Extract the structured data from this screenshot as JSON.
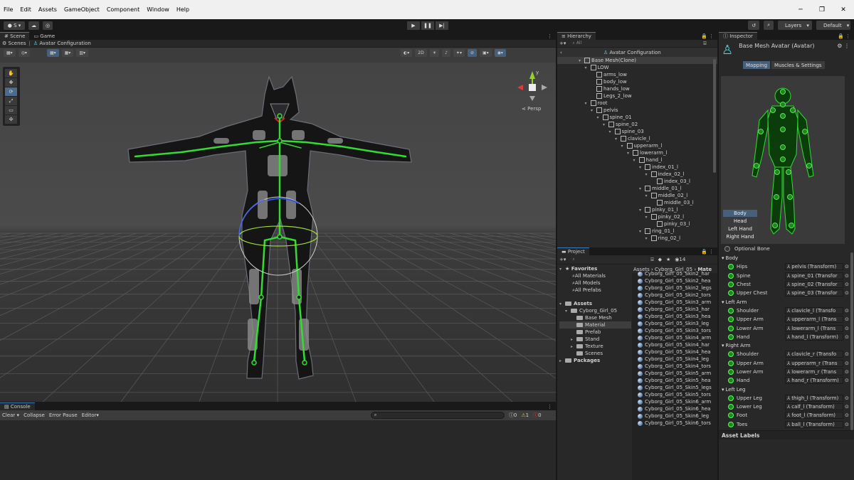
{
  "menu": [
    "File",
    "Edit",
    "Assets",
    "GameObject",
    "Component",
    "Window",
    "Help"
  ],
  "toolbar": {
    "account": "S",
    "layers": "Layers",
    "layout": "Default"
  },
  "scene": {
    "tab_scene": "Scene",
    "tab_game": "Game",
    "breadcrumb_root": "Scenes",
    "breadcrumb_current": "Avatar Configuration",
    "mode_2d": "2D",
    "persp": "Persp",
    "axis_y": "y"
  },
  "hierarchy": {
    "title": "Hierarchy",
    "search_placeholder": "All",
    "root": "Avatar Configuration",
    "rows": [
      {
        "label": "Base Mesh(Clone)",
        "depth": 0,
        "exp": true
      },
      {
        "label": "LOW",
        "depth": 1,
        "exp": true
      },
      {
        "label": "arms_low",
        "depth": 2,
        "exp": false
      },
      {
        "label": "body_low",
        "depth": 2,
        "exp": false
      },
      {
        "label": "hands_low",
        "depth": 2,
        "exp": false
      },
      {
        "label": "Legs_2_low",
        "depth": 2,
        "exp": false
      },
      {
        "label": "root",
        "depth": 1,
        "exp": true
      },
      {
        "label": "pelvis",
        "depth": 2,
        "exp": true
      },
      {
        "label": "spine_01",
        "depth": 3,
        "exp": true
      },
      {
        "label": "spine_02",
        "depth": 4,
        "exp": true
      },
      {
        "label": "spine_03",
        "depth": 5,
        "exp": true
      },
      {
        "label": "clavicle_l",
        "depth": 6,
        "exp": true
      },
      {
        "label": "upperarm_l",
        "depth": 7,
        "exp": true
      },
      {
        "label": "lowerarm_l",
        "depth": 8,
        "exp": true
      },
      {
        "label": "hand_l",
        "depth": 9,
        "exp": true
      },
      {
        "label": "index_01_l",
        "depth": 10,
        "exp": true
      },
      {
        "label": "index_02_l",
        "depth": 11,
        "exp": true
      },
      {
        "label": "index_03_l",
        "depth": 12,
        "exp": false
      },
      {
        "label": "middle_01_l",
        "depth": 10,
        "exp": true
      },
      {
        "label": "middle_02_l",
        "depth": 11,
        "exp": true
      },
      {
        "label": "middle_03_l",
        "depth": 12,
        "exp": false
      },
      {
        "label": "pinky_01_l",
        "depth": 10,
        "exp": true
      },
      {
        "label": "pinky_02_l",
        "depth": 11,
        "exp": true
      },
      {
        "label": "pinky_03_l",
        "depth": 12,
        "exp": false
      },
      {
        "label": "ring_01_l",
        "depth": 10,
        "exp": true
      },
      {
        "label": "ring_02_l",
        "depth": 11,
        "exp": true
      }
    ]
  },
  "project": {
    "title": "Project",
    "count": "14",
    "favorites": {
      "label": "Favorites",
      "items": [
        "All Materials",
        "All Models",
        "All Prefabs"
      ]
    },
    "assets": {
      "label": "Assets",
      "folder": "Cyborg_Girl_05",
      "children": [
        "Base Mesh",
        "Material",
        "Prefab",
        "Stand",
        "Texture",
        "Scenes"
      ],
      "packages": "Packages"
    },
    "path": [
      "Assets",
      "Cyborg_Girl_05",
      "Mate"
    ],
    "files": [
      "Cyborg_Girl_05_Skin2_har",
      "Cyborg_Girl_05_Skin2_hea",
      "Cyborg_Girl_05_Skin2_legs",
      "Cyborg_Girl_05_Skin2_tors",
      "Cyborg_Girl_05_Skin3_arm",
      "Cyborg_Girl_05_Skin3_har",
      "Cyborg_Girl_05_Skin3_hea",
      "Cyborg_Girl_05_Skin3_leg",
      "Cyborg_Girl_05_Skin3_tors",
      "Cyborg_Girl_05_Skin4_arm",
      "Cyborg_Girl_05_Skin4_har",
      "Cyborg_Girl_05_Skin4_hea",
      "Cyborg_Girl_05_Skin4_leg",
      "Cyborg_Girl_05_Skin4_tors",
      "Cyborg_Girl_05_Skin5_arm",
      "Cyborg_Girl_05_Skin5_hea",
      "Cyborg_Girl_05_Skin5_legs",
      "Cyborg_Girl_05_Skin5_tors",
      "Cyborg_Girl_05_Skin6_arm",
      "Cyborg_Girl_05_Skin6_hea",
      "Cyborg_Girl_05_Skin6_leg",
      "Cyborg_Girl_05_Skin6_tors"
    ]
  },
  "inspector": {
    "title": "Inspector",
    "object": "Base Mesh Avatar (Avatar)",
    "tab_mapping": "Mapping",
    "tab_muscles": "Muscles & Settings",
    "parts": [
      "Body",
      "Head",
      "Left Hand",
      "Right Hand"
    ],
    "optional_bone": "Optional Bone",
    "groups": [
      {
        "name": "Body",
        "bones": [
          [
            "Hips",
            "pelvis (Transform)"
          ],
          [
            "Spine",
            "spine_01 (Transfor"
          ],
          [
            "Chest",
            "spine_02 (Transfor"
          ],
          [
            "Upper Chest",
            "spine_03 (Transfor"
          ]
        ]
      },
      {
        "name": "Left Arm",
        "bones": [
          [
            "Shoulder",
            "clavicle_l (Transfo"
          ],
          [
            "Upper Arm",
            "upperarm_l (Trans"
          ],
          [
            "Lower Arm",
            "lowerarm_l (Trans"
          ],
          [
            "Hand",
            "hand_l (Transform)"
          ]
        ]
      },
      {
        "name": "Right Arm",
        "bones": [
          [
            "Shoulder",
            "clavicle_r (Transfo"
          ],
          [
            "Upper Arm",
            "upperarm_r (Trans"
          ],
          [
            "Lower Arm",
            "lowerarm_r (Trans"
          ],
          [
            "Hand",
            "hand_r (Transform)"
          ]
        ]
      },
      {
        "name": "Left Leg",
        "bones": [
          [
            "Upper Leg",
            "thigh_l (Transform)"
          ],
          [
            "Lower Leg",
            "calf_l (Transform)"
          ],
          [
            "Foot",
            "foot_l (Transform)"
          ],
          [
            "Toes",
            "ball_l (Transform)"
          ]
        ]
      }
    ],
    "asset_labels": "Asset Labels"
  },
  "console": {
    "title": "Console",
    "clear": "Clear",
    "collapse": "Collapse",
    "error_pause": "Error Pause",
    "editor": "Editor",
    "info_count": "0",
    "warn_count": "1",
    "error_count": "0"
  },
  "colors": {
    "accent": "#46607c",
    "bone": "#32dc32",
    "bg": "#282828"
  }
}
